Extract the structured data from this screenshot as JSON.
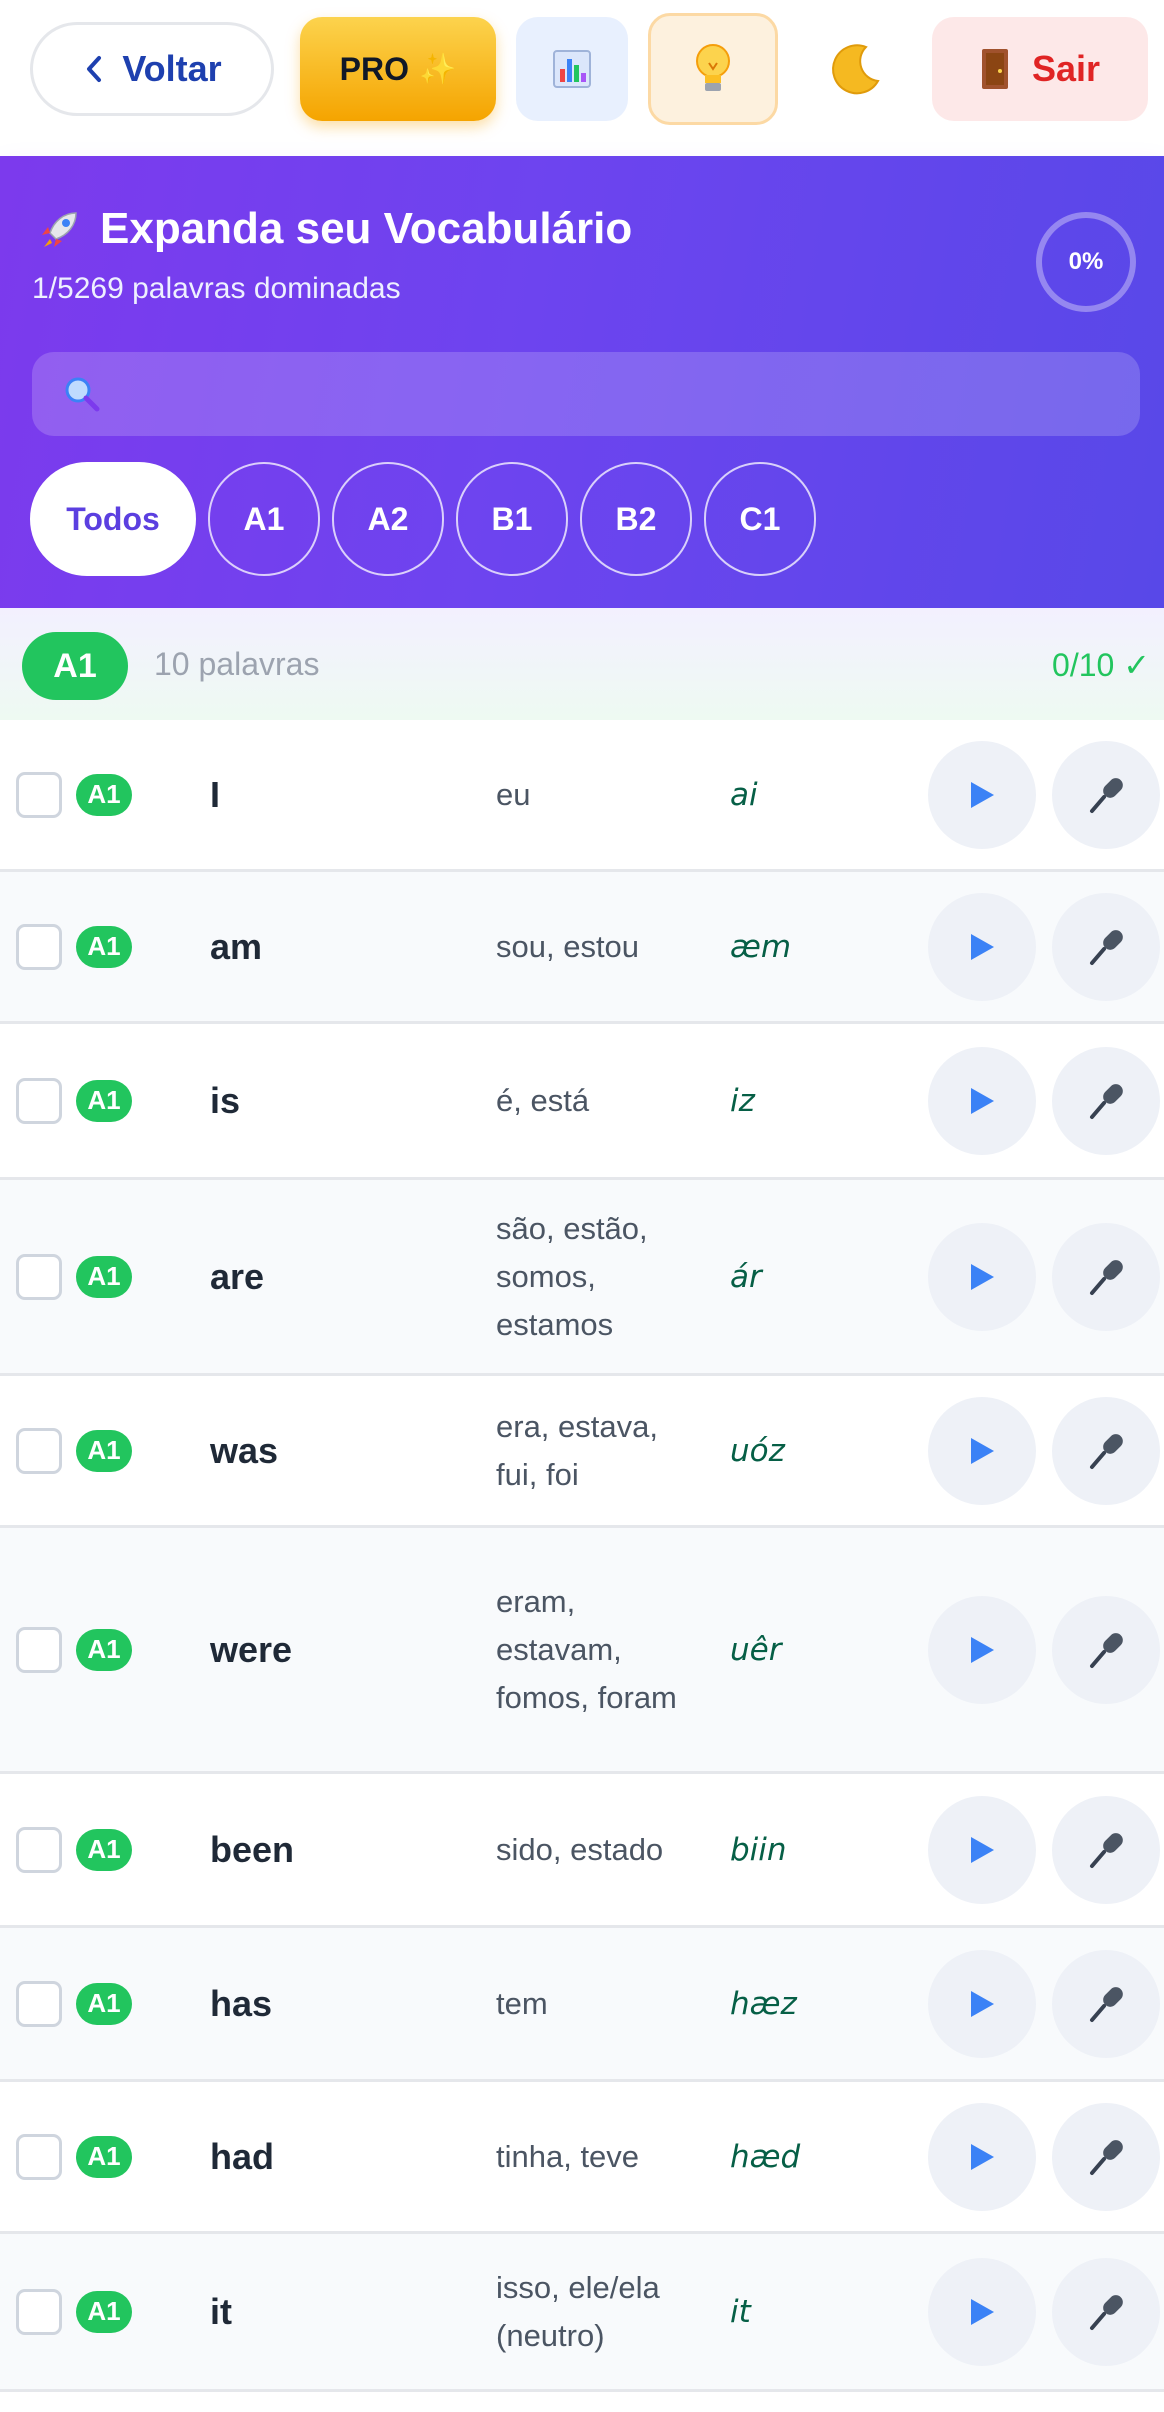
{
  "toolbar": {
    "back_label": "Voltar",
    "pro_label": "PRO",
    "pro_spark": "✨",
    "exit_label": "Sair",
    "icons": [
      "chevron-left-icon",
      "bar-chart-icon",
      "lightbulb-icon",
      "moon-icon",
      "door-icon"
    ]
  },
  "hero": {
    "title": "Expanda seu Vocabulário",
    "title_icon": "rocket-icon",
    "subtitle": "1/5269 palavras dominadas",
    "progress": "0%",
    "search_placeholder": "",
    "filters": [
      "Todos",
      "A1",
      "A2",
      "B1",
      "B2",
      "C1"
    ],
    "active_filter": "Todos"
  },
  "group": {
    "level": "A1",
    "count_label": "10 palavras",
    "progress_label": "0/10 ✓"
  },
  "words": [
    {
      "level": "A1",
      "word": "I",
      "translation": "eu",
      "ipa": "ai"
    },
    {
      "level": "A1",
      "word": "am",
      "translation": "sou, estou",
      "ipa": "æm"
    },
    {
      "level": "A1",
      "word": "is",
      "translation": "é, está",
      "ipa": "iz"
    },
    {
      "level": "A1",
      "word": "are",
      "translation": "são, estão, somos, estamos",
      "ipa": "ár"
    },
    {
      "level": "A1",
      "word": "was",
      "translation": "era, estava, fui, foi",
      "ipa": "uóz"
    },
    {
      "level": "A1",
      "word": "were",
      "translation": "eram, estavam, fomos, foram",
      "ipa": "uêr"
    },
    {
      "level": "A1",
      "word": "been",
      "translation": "sido, estado",
      "ipa": "biin"
    },
    {
      "level": "A1",
      "word": "has",
      "translation": "tem",
      "ipa": "hæz"
    },
    {
      "level": "A1",
      "word": "had",
      "translation": "tinha, teve",
      "ipa": "hæd"
    },
    {
      "level": "A1",
      "word": "it",
      "translation": "isso, ele/ela (neutro)",
      "ipa": "it"
    }
  ],
  "colors": {
    "accent_purple": "#7c3aed",
    "level_green": "#22c55e",
    "play_blue": "#3b82f6",
    "exit_red": "#e02424"
  }
}
